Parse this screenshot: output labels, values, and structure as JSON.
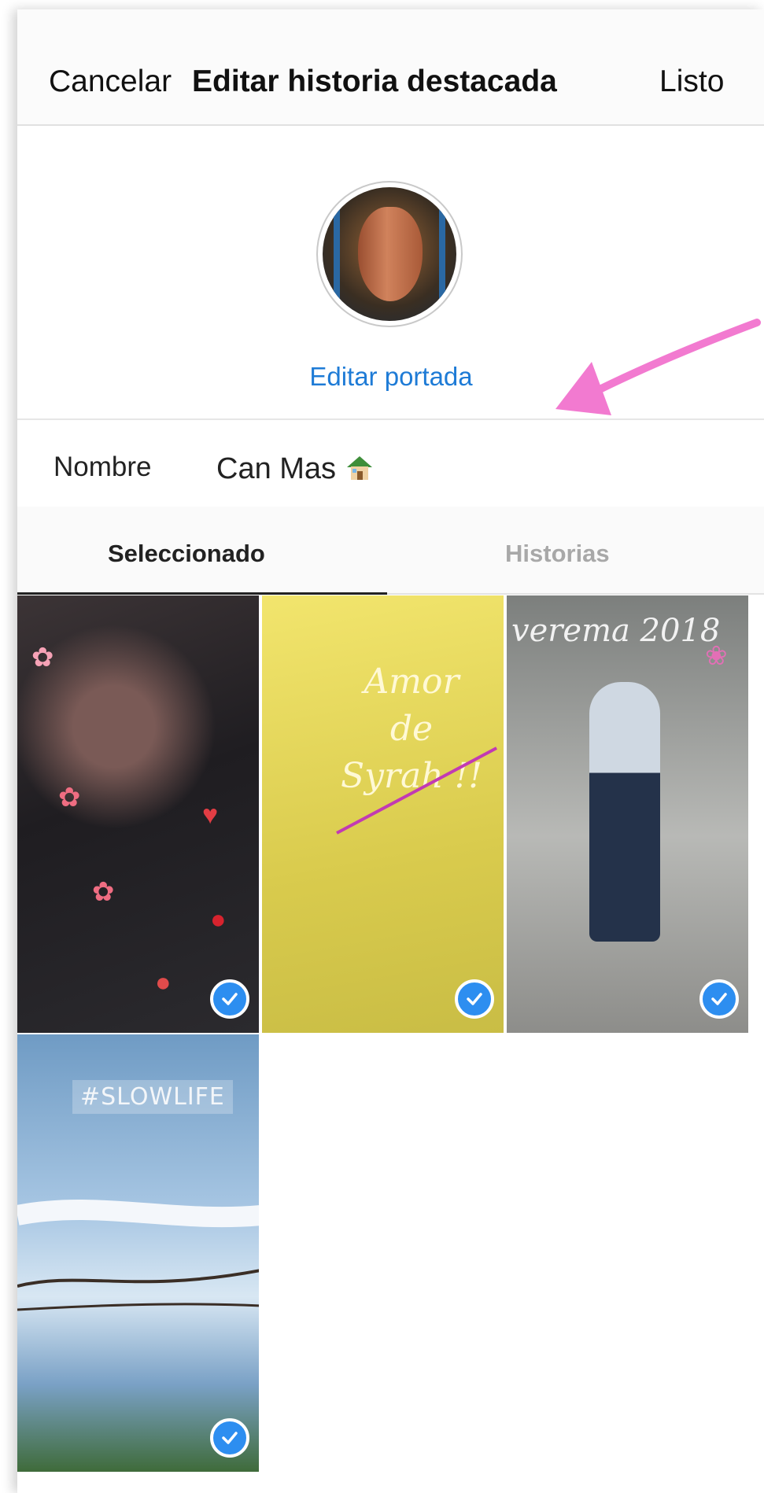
{
  "header": {
    "cancel_label": "Cancelar",
    "title": "Editar historia destacada",
    "done_label": "Listo"
  },
  "cover": {
    "edit_label": "Editar portada"
  },
  "name_field": {
    "label": "Nombre",
    "value": "Can Mas"
  },
  "tabs": [
    {
      "label": "Seleccionado",
      "active": true
    },
    {
      "label": "Historias",
      "active": false
    }
  ],
  "stories": [
    {
      "selected": true
    },
    {
      "selected": true,
      "overlay_text": [
        "Amor",
        "de",
        "Syrah !!"
      ]
    },
    {
      "selected": true,
      "overlay_text": "verema 2018"
    },
    {
      "selected": true,
      "overlay_text": "#SLOWLIFE"
    }
  ],
  "colors": {
    "accent_blue": "#1e7bd6",
    "check_blue": "#2d8ef0",
    "annotation_pink": "#f27ad0"
  }
}
